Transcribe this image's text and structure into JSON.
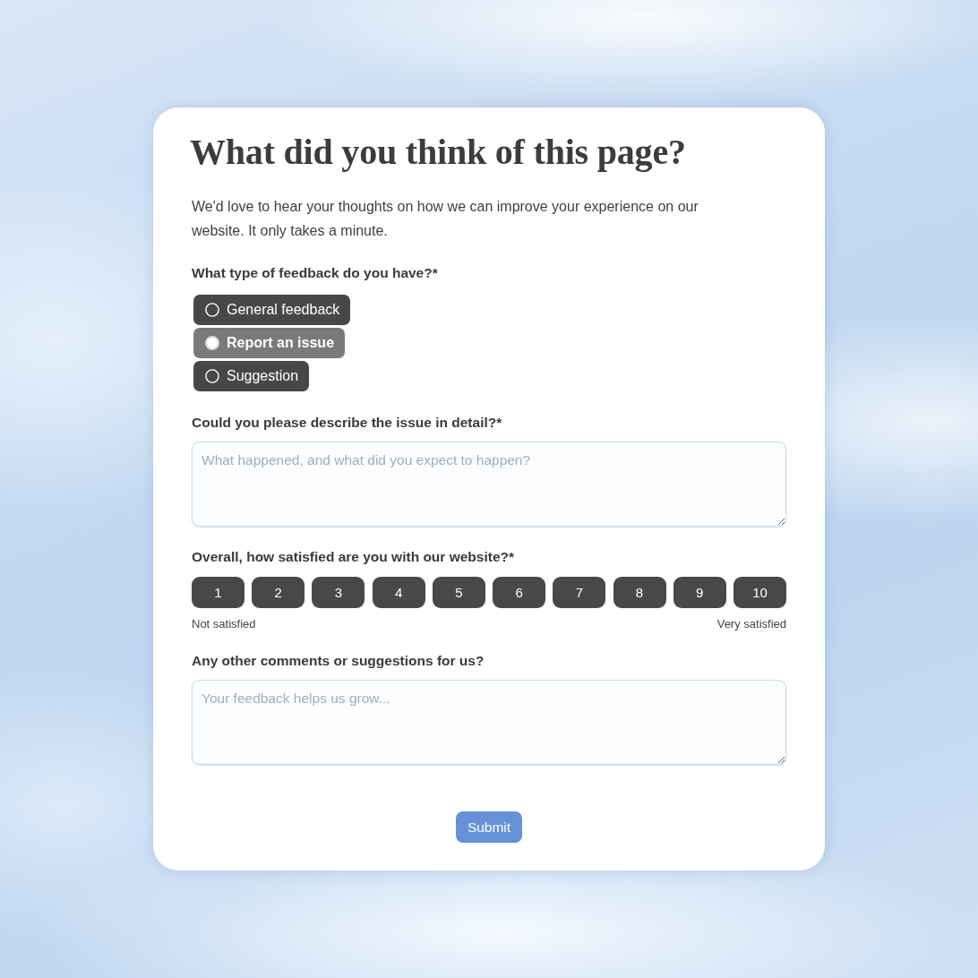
{
  "heading": "What did you think of this page?",
  "intro": "We'd love to hear your thoughts on how we can improve your experience on our website. It only takes a minute.",
  "questions": [
    {
      "kind": "radio",
      "label": "What type of feedback do you have?*",
      "options": [
        {
          "label": "General feedback",
          "selected": false
        },
        {
          "label": "Report an issue",
          "selected": true
        },
        {
          "label": "Suggestion",
          "selected": false
        }
      ]
    },
    {
      "kind": "textarea",
      "label": "Could you please describe the issue in detail?*",
      "placeholder": "What happened, and what did you expect to happen?"
    },
    {
      "kind": "scale",
      "label": "Overall, how satisfied are you with our website?*",
      "options": [
        {
          "label": "1",
          "selected": false
        },
        {
          "label": "2",
          "selected": false
        },
        {
          "label": "3",
          "selected": false
        },
        {
          "label": "4",
          "selected": false
        },
        {
          "label": "5",
          "selected": false
        },
        {
          "label": "6",
          "selected": false
        },
        {
          "label": "7",
          "selected": false
        },
        {
          "label": "8",
          "selected": false
        },
        {
          "label": "9",
          "selected": false
        },
        {
          "label": "10",
          "selected": false
        }
      ],
      "min_label": "Not satisfied",
      "max_label": "Very satisfied"
    },
    {
      "kind": "textarea",
      "label": "Any other comments or suggestions for us?",
      "placeholder": "Your feedback helps us grow..."
    }
  ],
  "submit": "Submit"
}
